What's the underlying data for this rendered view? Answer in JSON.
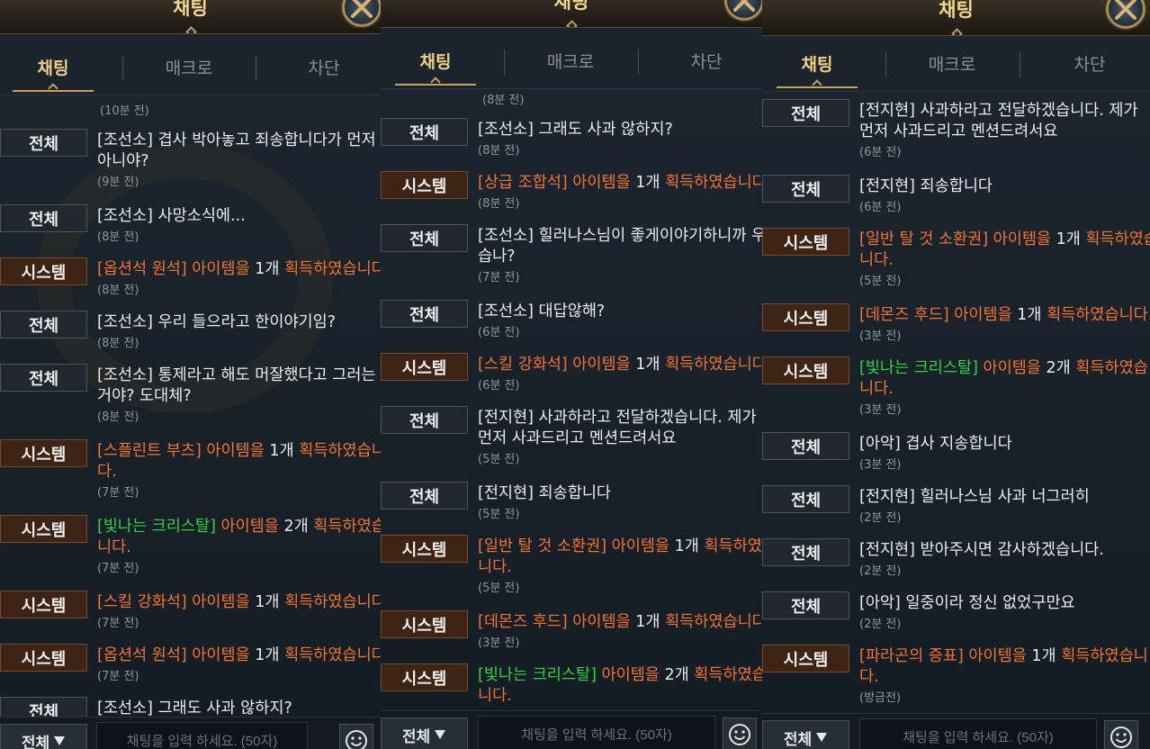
{
  "screens": [
    {
      "title": "채팅",
      "tabs": [
        "채팅",
        "매크로",
        "차단"
      ],
      "first_time": "(10분 전)",
      "input_placeholder": "채팅을 입력 하세요. (50자)",
      "channel_select": "전체",
      "messages": [
        {
          "tag": "전체",
          "kind": "all",
          "lines": [
            [
              [
                "w",
                "[조선소] 겹사 박아놓고 죄송합니다가 먼저"
              ]
            ],
            [
              [
                "w",
                "아니야?"
              ]
            ]
          ],
          "time": "(9분 전)"
        },
        {
          "tag": "전체",
          "kind": "all",
          "lines": [
            [
              [
                "w",
                "[조선소] 사망소식에..."
              ]
            ]
          ],
          "time": "(8분 전)"
        },
        {
          "tag": "시스템",
          "kind": "sys",
          "lines": [
            [
              [
                "o",
                "[옵션석 원석]"
              ],
              [
                "w",
                " "
              ],
              [
                "o",
                "아이템을"
              ],
              [
                "w",
                " 1개 "
              ],
              [
                "o",
                "획득하였습니다."
              ]
            ]
          ],
          "time": "(8분 전)"
        },
        {
          "tag": "전체",
          "kind": "all",
          "lines": [
            [
              [
                "w",
                "[조선소] 우리 들으라고 한이야기임?"
              ]
            ]
          ],
          "time": "(8분 전)"
        },
        {
          "tag": "전체",
          "kind": "all",
          "lines": [
            [
              [
                "w",
                "[조선소] 통제라고 해도 머잘했다고 그러는"
              ]
            ],
            [
              [
                "w",
                "거야? 도대체?"
              ]
            ]
          ],
          "time": "(8분 전)"
        },
        {
          "tag": "시스템",
          "kind": "sys",
          "lines": [
            [
              [
                "o",
                "[스플린트 부츠]"
              ],
              [
                "w",
                " "
              ],
              [
                "o",
                "아이템을"
              ],
              [
                "w",
                " 1개 "
              ],
              [
                "o",
                "획득하였습니"
              ]
            ],
            [
              [
                "o",
                "다."
              ]
            ]
          ],
          "time": "(7분 전)"
        },
        {
          "tag": "시스템",
          "kind": "sys",
          "lines": [
            [
              [
                "g",
                "[빛나는 크리스탈]"
              ],
              [
                "w",
                " "
              ],
              [
                "o",
                "아이템을"
              ],
              [
                "w",
                " 2개 "
              ],
              [
                "o",
                "획득하였습"
              ]
            ],
            [
              [
                "o",
                "니다."
              ]
            ]
          ],
          "time": "(7분 전)"
        },
        {
          "tag": "시스템",
          "kind": "sys",
          "lines": [
            [
              [
                "o",
                "[스킬 강화석]"
              ],
              [
                "w",
                " "
              ],
              [
                "o",
                "아이템을"
              ],
              [
                "w",
                " 1개 "
              ],
              [
                "o",
                "획득하였습니다."
              ]
            ]
          ],
          "time": "(7분 전)"
        },
        {
          "tag": "시스템",
          "kind": "sys",
          "lines": [
            [
              [
                "o",
                "[옵션석 원석]"
              ],
              [
                "w",
                " "
              ],
              [
                "o",
                "아이템을"
              ],
              [
                "w",
                " 1개 "
              ],
              [
                "o",
                "획득하였습니다."
              ]
            ]
          ],
          "time": "(7분 전)"
        },
        {
          "tag": "전체",
          "kind": "all",
          "lines": [
            [
              [
                "w",
                "[조선소] 그래도 사과 않하지?"
              ]
            ]
          ],
          "time": ""
        }
      ]
    },
    {
      "title": "채팅",
      "tabs": [
        "채팅",
        "매크로",
        "차단"
      ],
      "first_time": "(8분 전)",
      "input_placeholder": "채팅을 입력 하세요. (50자)",
      "channel_select": "전체",
      "messages": [
        {
          "tag": "전체",
          "kind": "all",
          "lines": [
            [
              [
                "w",
                "[조선소] 그래도 사과 않하지?"
              ]
            ]
          ],
          "time": "(8분 전)"
        },
        {
          "tag": "시스템",
          "kind": "sys",
          "lines": [
            [
              [
                "o",
                "[상급 조합석]"
              ],
              [
                "w",
                " "
              ],
              [
                "o",
                "아이템을"
              ],
              [
                "w",
                " 1개 "
              ],
              [
                "o",
                "획득하였습니다."
              ]
            ]
          ],
          "time": "(8분 전)"
        },
        {
          "tag": "전체",
          "kind": "all",
          "lines": [
            [
              [
                "w",
                "[조선소] 힐러나스님이 좋게이야기하니까 우"
              ]
            ],
            [
              [
                "w",
                "습나?"
              ]
            ]
          ],
          "time": "(7분 전)"
        },
        {
          "tag": "전체",
          "kind": "all",
          "lines": [
            [
              [
                "w",
                "[조선소] 대답않해?"
              ]
            ]
          ],
          "time": "(6분 전)"
        },
        {
          "tag": "시스템",
          "kind": "sys",
          "lines": [
            [
              [
                "o",
                "[스킬 강화석]"
              ],
              [
                "w",
                " "
              ],
              [
                "o",
                "아이템을"
              ],
              [
                "w",
                " 1개 "
              ],
              [
                "o",
                "획득하였습니다."
              ]
            ]
          ],
          "time": "(6분 전)"
        },
        {
          "tag": "전체",
          "kind": "all",
          "lines": [
            [
              [
                "w",
                "[전지현] 사과하라고 전달하겠습니다. 제가"
              ]
            ],
            [
              [
                "w",
                "먼저 사과드리고 멘션드려서요"
              ]
            ]
          ],
          "time": "(5분 전)"
        },
        {
          "tag": "전체",
          "kind": "all",
          "lines": [
            [
              [
                "w",
                "[전지현] 죄송합니다"
              ]
            ]
          ],
          "time": "(5분 전)"
        },
        {
          "tag": "시스템",
          "kind": "sys",
          "lines": [
            [
              [
                "o",
                "[일반 탈 것 소환권]"
              ],
              [
                "w",
                " "
              ],
              [
                "o",
                "아이템을"
              ],
              [
                "w",
                " 1개 "
              ],
              [
                "o",
                "획득하였습"
              ]
            ],
            [
              [
                "o",
                "니다."
              ]
            ]
          ],
          "time": "(5분 전)"
        },
        {
          "tag": "시스템",
          "kind": "sys",
          "lines": [
            [
              [
                "o",
                "[데몬즈 후드]"
              ],
              [
                "w",
                " "
              ],
              [
                "o",
                "아이템을"
              ],
              [
                "w",
                " 1개 "
              ],
              [
                "o",
                "획득하였습니다."
              ]
            ]
          ],
          "time": "(3분 전)"
        },
        {
          "tag": "시스템",
          "kind": "sys",
          "lines": [
            [
              [
                "g",
                "[빛나는 크리스탈]"
              ],
              [
                "w",
                " "
              ],
              [
                "o",
                "아이템을"
              ],
              [
                "w",
                " 2개 "
              ],
              [
                "o",
                "획득하였습"
              ]
            ],
            [
              [
                "o",
                "니다."
              ]
            ]
          ],
          "time": ""
        }
      ]
    },
    {
      "title": "채팅",
      "tabs": [
        "채팅",
        "매크로",
        "차단"
      ],
      "first_time": "",
      "input_placeholder": "채팅을 입력 하세요. (50자)",
      "channel_select": "전체",
      "messages": [
        {
          "tag": "전체",
          "kind": "all",
          "lines": [
            [
              [
                "w",
                "[전지현] 사과하라고 전달하겠습니다. 제가"
              ]
            ],
            [
              [
                "w",
                "먼저 사과드리고 멘션드려서요"
              ]
            ]
          ],
          "time": "(6분 전)"
        },
        {
          "tag": "전체",
          "kind": "all",
          "lines": [
            [
              [
                "w",
                "[전지현] 죄송합니다"
              ]
            ]
          ],
          "time": "(6분 전)"
        },
        {
          "tag": "시스템",
          "kind": "sys",
          "lines": [
            [
              [
                "o",
                "[일반 탈 것 소환권]"
              ],
              [
                "w",
                " "
              ],
              [
                "o",
                "아이템을"
              ],
              [
                "w",
                " 1개 "
              ],
              [
                "o",
                "획득하였습"
              ]
            ],
            [
              [
                "o",
                "니다."
              ]
            ]
          ],
          "time": "(5분 전)"
        },
        {
          "tag": "시스템",
          "kind": "sys",
          "lines": [
            [
              [
                "o",
                "[데몬즈 후드]"
              ],
              [
                "w",
                " "
              ],
              [
                "o",
                "아이템을"
              ],
              [
                "w",
                " 1개 "
              ],
              [
                "o",
                "획득하였습니다."
              ]
            ]
          ],
          "time": "(3분 전)"
        },
        {
          "tag": "시스템",
          "kind": "sys",
          "lines": [
            [
              [
                "g",
                "[빛나는 크리스탈]"
              ],
              [
                "w",
                " "
              ],
              [
                "o",
                "아이템을"
              ],
              [
                "w",
                " 2개 "
              ],
              [
                "o",
                "획득하였습"
              ]
            ],
            [
              [
                "o",
                "니다."
              ]
            ]
          ],
          "time": "(3분 전)"
        },
        {
          "tag": "전체",
          "kind": "all",
          "lines": [
            [
              [
                "w",
                "[아악] 겹사 지송합니다"
              ]
            ]
          ],
          "time": "(3분 전)"
        },
        {
          "tag": "전체",
          "kind": "all",
          "lines": [
            [
              [
                "w",
                "[전지현] 힐러나스님 사과 너그러히"
              ]
            ]
          ],
          "time": "(2분 전)"
        },
        {
          "tag": "전체",
          "kind": "all",
          "lines": [
            [
              [
                "w",
                "[전지현] 받아주시면 감사하겠습니다."
              ]
            ]
          ],
          "time": "(2분 전)"
        },
        {
          "tag": "전체",
          "kind": "all",
          "lines": [
            [
              [
                "w",
                "[아악] 일중이라 정신 없었구만요"
              ]
            ]
          ],
          "time": "(2분 전)"
        },
        {
          "tag": "시스템",
          "kind": "sys",
          "lines": [
            [
              [
                "o",
                "[파라곤의 증표]"
              ],
              [
                "w",
                " "
              ],
              [
                "o",
                "아이템을"
              ],
              [
                "w",
                " 1개 "
              ],
              [
                "o",
                "획득하였습니"
              ]
            ],
            [
              [
                "o",
                "다."
              ]
            ]
          ],
          "time": "(방금전)"
        }
      ]
    }
  ],
  "colors": {
    "item_orange": "#f4742e",
    "item_green": "#34d23e",
    "gold_title": "#f2d58f"
  },
  "icons": {
    "close": "close-x-icon",
    "emoji": "smiley-icon",
    "dropdown": "triangle-down-icon"
  }
}
